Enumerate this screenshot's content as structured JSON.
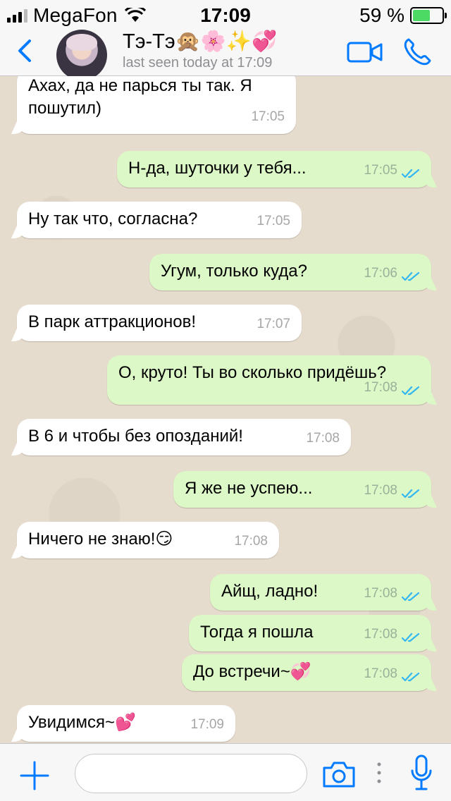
{
  "status_bar": {
    "carrier": "MegaFon",
    "time": "17:09",
    "battery_percent": "59 %",
    "battery_level": 0.59
  },
  "header": {
    "contact_name": "Тэ-Тэ🙊🌸✨💞",
    "last_seen": "last seen today at 17:09"
  },
  "messages": [
    {
      "dir": "in",
      "lines": [
        "Ахах, да не парься ты так. Я",
        "пошутил)"
      ],
      "time": "17:05"
    },
    {
      "dir": "out",
      "lines": [
        "Н-да, шуточки у тебя..."
      ],
      "time": "17:05"
    },
    {
      "dir": "in",
      "lines": [
        "Ну так что, согласна?"
      ],
      "time": "17:05"
    },
    {
      "dir": "out",
      "lines": [
        "Угум, только куда?"
      ],
      "time": "17:06"
    },
    {
      "dir": "in",
      "lines": [
        "В парк аттракционов!"
      ],
      "time": "17:07"
    },
    {
      "dir": "out",
      "lines": [
        "О, круто! Ты во сколько придёшь?"
      ],
      "time": "17:08"
    },
    {
      "dir": "in",
      "lines": [
        "В 6 и чтобы без опозданий!"
      ],
      "time": "17:08"
    },
    {
      "dir": "out",
      "lines": [
        "Я же не успею..."
      ],
      "time": "17:08"
    },
    {
      "dir": "in",
      "lines": [
        "Ничего не знаю!😏"
      ],
      "time": "17:08"
    },
    {
      "dir": "out",
      "lines": [
        "Айщ, ладно!"
      ],
      "time": "17:08"
    },
    {
      "dir": "out",
      "lines": [
        "Тогда я пошла"
      ],
      "time": "17:08"
    },
    {
      "dir": "out",
      "lines": [
        "До встречи~💞"
      ],
      "time": "17:08"
    },
    {
      "dir": "in",
      "lines": [
        "Увидимся~💕"
      ],
      "time": "17:09"
    }
  ],
  "input": {
    "value": "",
    "placeholder": ""
  },
  "colors": {
    "accent": "#007aff",
    "outgoing_bubble": "#dcf8c6",
    "incoming_bubble": "#ffffff",
    "read_ticks": "#34b7f1",
    "chat_background": "#e6dccd"
  },
  "icons": {
    "back": "chevron-left-icon",
    "video": "video-camera-icon",
    "call": "phone-icon",
    "attach": "plus-icon",
    "camera": "camera-icon",
    "mic": "microphone-icon"
  }
}
